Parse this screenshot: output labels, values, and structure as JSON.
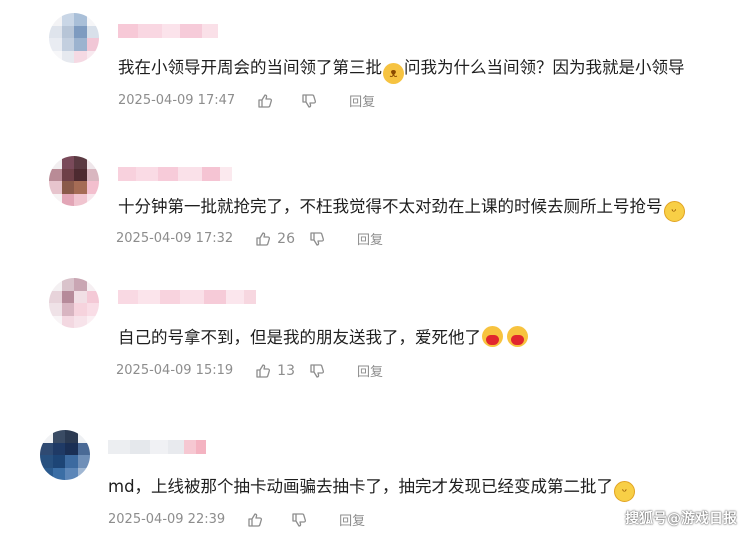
{
  "comments": [
    {
      "text": "我在小领导开周会的当间领了第三批",
      "text2": "问我为什么当间领？因为我就是小领导",
      "emoji": "cat-face-emoji",
      "time": "2025-04-09 17:47",
      "likes": "",
      "reply": "回复"
    },
    {
      "text": "十分钟第一批就抢完了，不枉我觉得不太对劲在上课的时候去厕所上号抢号",
      "emoji": "laughing-emoji",
      "time": "2025-04-09 17:32",
      "likes": "26",
      "reply": "回复"
    },
    {
      "text": "自己的号拿不到，但是我的朋友送我了，爱死他了",
      "emoji": "heart-face-emoji",
      "time": "2025-04-09 15:19",
      "likes": "13",
      "reply": "回复"
    },
    {
      "text": "md，上线被那个抽卡动画骗去抽卡了，抽完才发现已经变成第二批了",
      "emoji": "laughing-emoji",
      "time": "2025-04-09 22:39",
      "likes": "",
      "reply": "回复"
    }
  ],
  "watermark": "搜狐号@游戏日报",
  "colors": {
    "text": "#1e1e1e",
    "meta": "#8d8d8d",
    "emoji_yellow": "#f6c341"
  }
}
